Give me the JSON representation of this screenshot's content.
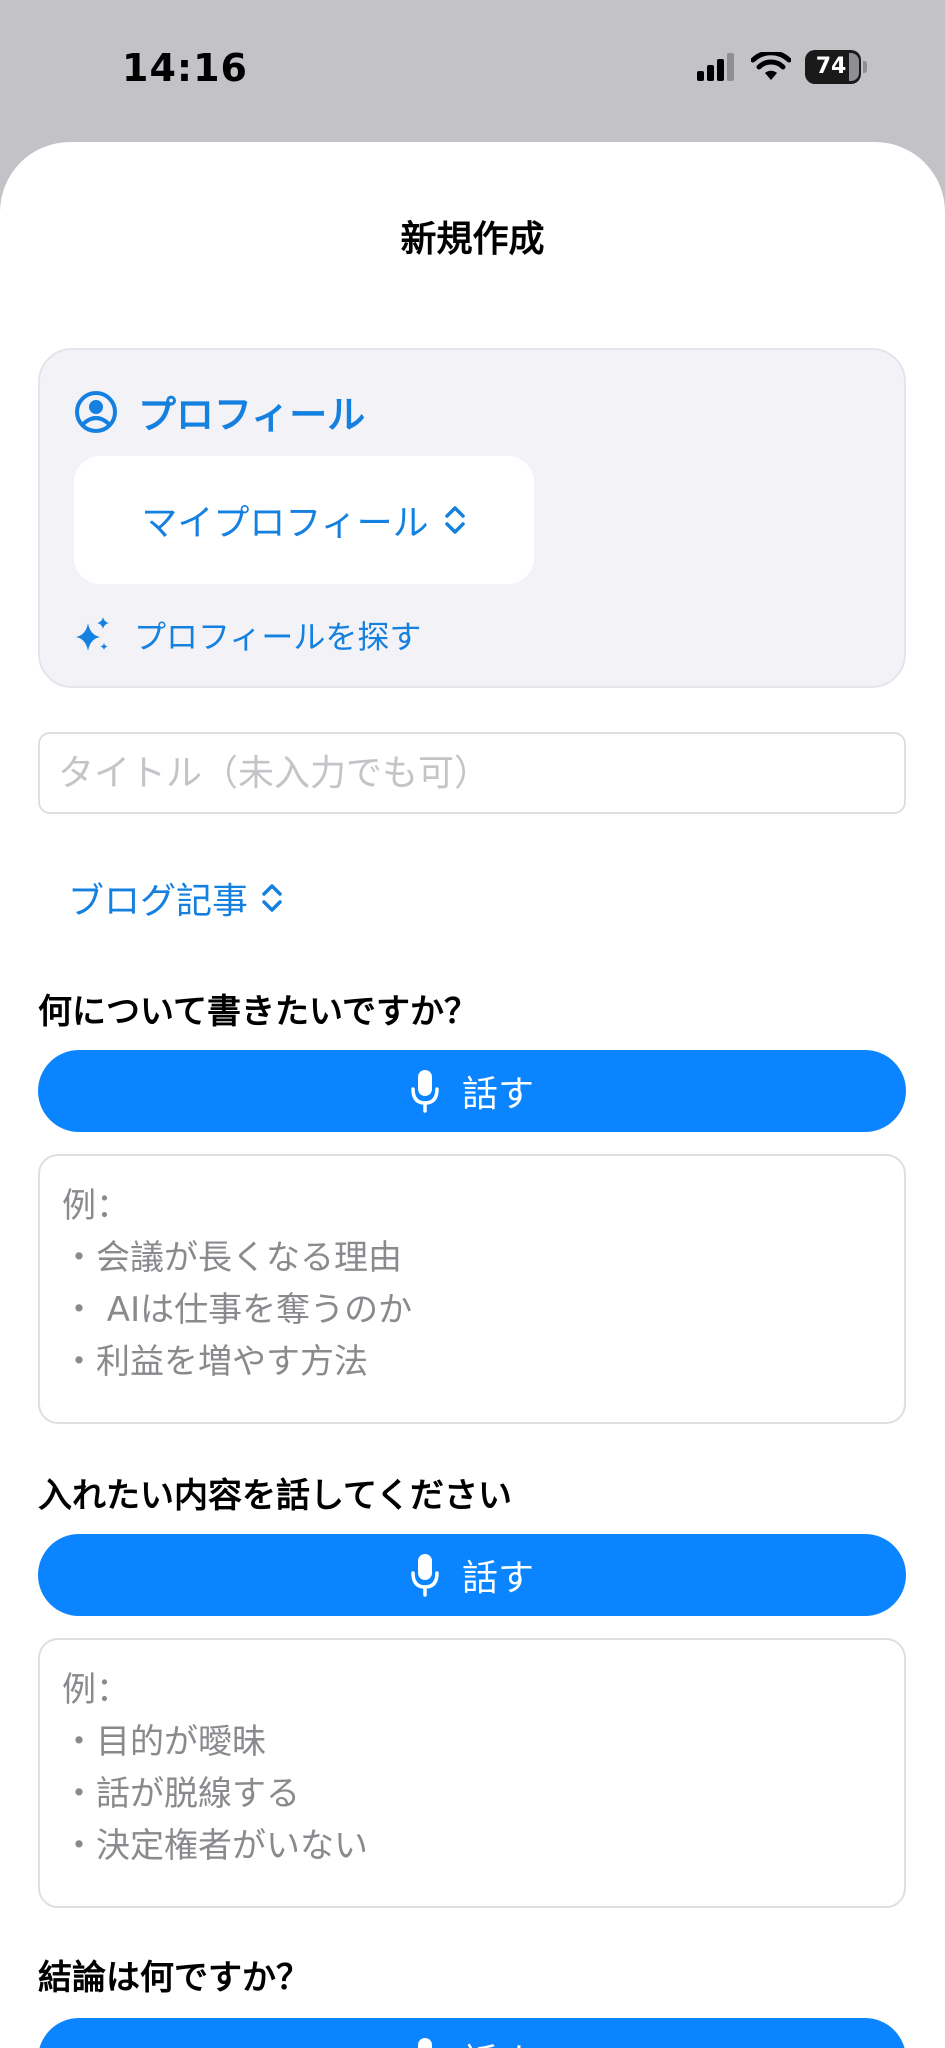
{
  "status": {
    "time": "14:16",
    "battery": "74"
  },
  "sheet": {
    "title": "新規作成"
  },
  "profile": {
    "label": "プロフィール",
    "selected": "マイプロフィール",
    "find_label": "プロフィールを探す"
  },
  "title_input": {
    "placeholder": "タイトル（未入力でも可）",
    "value": ""
  },
  "doc_type": {
    "selected": "ブログ記事"
  },
  "sections": [
    {
      "question": "何について書きたいですか？",
      "button_label": "話す",
      "example_heading": "例：",
      "examples": [
        "・会議が長くなる理由",
        "・ AIは仕事を奪うのか",
        "・利益を増やす方法"
      ]
    },
    {
      "question": "入れたい内容を話してください",
      "button_label": "話す",
      "example_heading": "例：",
      "examples": [
        "・目的が曖昧",
        "・話が脱線する",
        "・決定権者がいない"
      ]
    },
    {
      "question": "結論は何ですか？",
      "button_label": "話す"
    }
  ],
  "colors": {
    "accent": "#0a84ff",
    "link": "#1480e0",
    "card_bg": "#f2f2f7",
    "backdrop": "#c2c2c7"
  },
  "icons": [
    "signal-icon",
    "wifi-icon",
    "battery-icon",
    "person-circle-icon",
    "chevron-updown-icon",
    "sparkles-icon",
    "microphone-icon"
  ]
}
